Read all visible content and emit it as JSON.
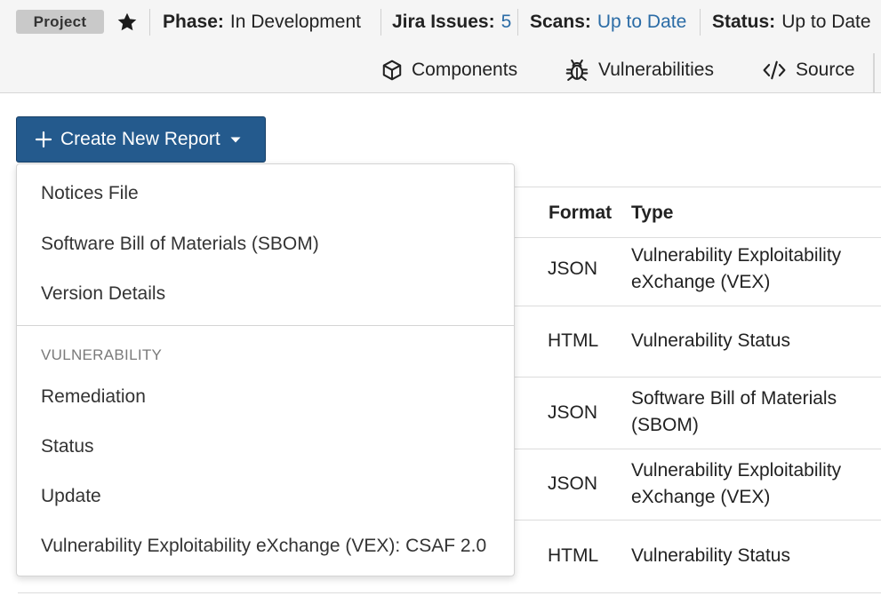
{
  "header": {
    "badge": "Project",
    "phase_label": "Phase:",
    "phase_value": "In Development",
    "jira_label": "Jira Issues:",
    "jira_value": "5",
    "scans_label": "Scans:",
    "scans_value": "Up to Date",
    "status_label": "Status:",
    "status_value": "Up to Date"
  },
  "tabs": [
    {
      "label": "Components",
      "icon": "cube-icon"
    },
    {
      "label": "Vulnerabilities",
      "icon": "bug-icon"
    },
    {
      "label": "Source",
      "icon": "code-icon"
    }
  ],
  "create_button": {
    "label": "Create New Report"
  },
  "dropdown": {
    "items": [
      "Notices File",
      "Software Bill of Materials (SBOM)",
      "Version Details"
    ],
    "section_header": "VULNERABILITY",
    "vuln_items": [
      "Remediation",
      "Status",
      "Update",
      "Vulnerability Exploitability eXchange (VEX): CSAF 2.0"
    ]
  },
  "table": {
    "headers": {
      "format": "Format",
      "type": "Type"
    },
    "rows": [
      {
        "format": "JSON",
        "type": "Vulnerability Exploitability eXchange (VEX)"
      },
      {
        "format": "HTML",
        "type": "Vulnerability Status"
      },
      {
        "format": "JSON",
        "type": "Software Bill of Materials (SBOM)"
      },
      {
        "format": "JSON",
        "type": "Vulnerability Exploitability eXchange (VEX)"
      },
      {
        "format": "HTML",
        "type": "Vulnerability Status"
      }
    ]
  },
  "colors": {
    "primary": "#245a8d",
    "link": "#2b6ca6",
    "badge": "#c9c9c9"
  }
}
